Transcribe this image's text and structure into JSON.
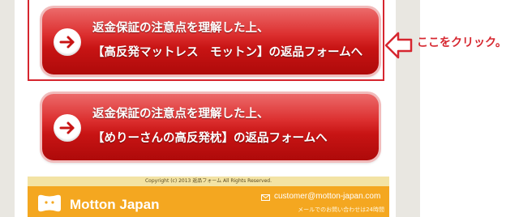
{
  "buttons": [
    {
      "line1": "返金保証の注意点を理解した上、",
      "line2": "【高反発マットレス　モットン】の返品フォームへ"
    },
    {
      "line1": "返金保証の注意点を理解した上、",
      "line2": "【めりーさんの高反発枕】の返品フォームへ"
    }
  ],
  "annotation": {
    "text": "ここをクリック。"
  },
  "footer": {
    "copyright": "Copyright (c) 2013 返品フォーム All Rights Reserved.",
    "logo_text": "Motton Japan",
    "email": "customer@motton-japan.com",
    "mail_note": "メールでのお問い合わせは24時間"
  },
  "colors": {
    "button_red": "#d22424",
    "annotation_red": "#d6262f",
    "footer_orange": "#f4a720"
  },
  "icons": [
    "arrow-right-icon",
    "hollow-left-arrow-icon",
    "mail-icon",
    "motton-logo-icon"
  ]
}
